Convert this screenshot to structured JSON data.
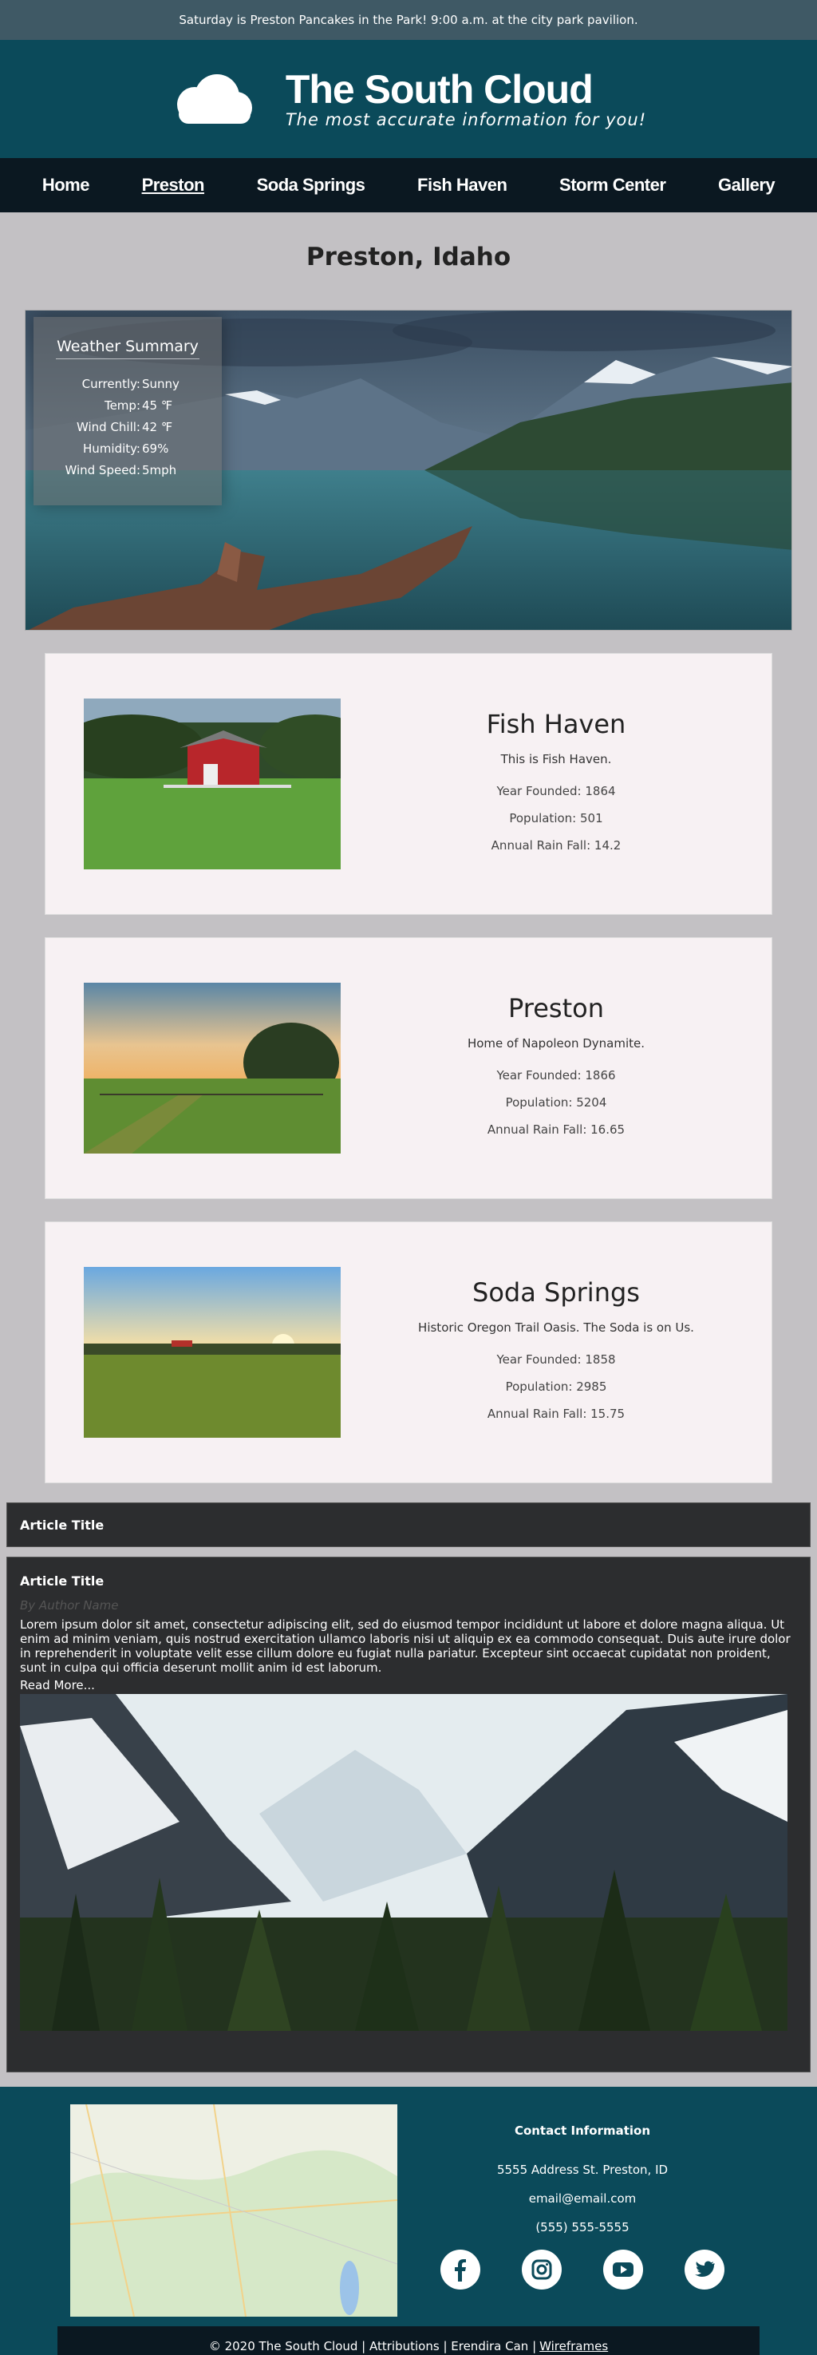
{
  "announcement": "Saturday is Preston Pancakes in the Park! 9:00 a.m. at the city park pavilion.",
  "brand": {
    "title": "The South Cloud",
    "tagline": "The most accurate information for you!",
    "icon": "cloud-icon"
  },
  "nav": {
    "items": [
      {
        "label": "Home"
      },
      {
        "label": "Preston"
      },
      {
        "label": "Soda Springs"
      },
      {
        "label": "Fish Haven"
      },
      {
        "label": "Storm Center"
      },
      {
        "label": "Gallery"
      }
    ],
    "active_index": 1
  },
  "page_title": "Preston, Idaho",
  "weather": {
    "heading": "Weather Summary",
    "rows": [
      {
        "label": "Currently:",
        "value": "Sunny"
      },
      {
        "label": "Temp:",
        "value": "45 ℉"
      },
      {
        "label": "Wind Chill:",
        "value": "42 ℉"
      },
      {
        "label": "Humidity:",
        "value": "69%"
      },
      {
        "label": "Wind Speed:",
        "value": "5mph"
      }
    ]
  },
  "towns": [
    {
      "name": "Fish Haven",
      "motto": "This is Fish Haven.",
      "founded": "Year Founded: 1864",
      "population": "Population: 501",
      "rain": "Annual Rain Fall: 14.2"
    },
    {
      "name": "Preston",
      "motto": "Home of Napoleon Dynamite.",
      "founded": "Year Founded: 1866",
      "population": "Population: 5204",
      "rain": "Annual Rain Fall: 16.65"
    },
    {
      "name": "Soda Springs",
      "motto": "Historic Oregon Trail Oasis. The Soda is on Us.",
      "founded": "Year Founded: 1858",
      "population": "Population: 2985",
      "rain": "Annual Rain Fall: 15.75"
    }
  ],
  "article_bar": {
    "title": "Article Title"
  },
  "article": {
    "title": "Article Title",
    "author": "By Author Name",
    "body": "Lorem ipsum dolor sit amet, consectetur adipiscing elit, sed do eiusmod tempor incididunt ut labore et dolore magna aliqua. Ut enim ad minim veniam, quis nostrud exercitation ullamco laboris nisi ut aliquip ex ea commodo consequat. Duis aute irure dolor in reprehenderit in voluptate velit esse cillum dolore eu fugiat nulla pariatur. Excepteur sint occaecat cupidatat non proident, sunt in culpa qui officia deserunt mollit anim id est laborum.",
    "read_more": "Read More..."
  },
  "contact": {
    "heading": "Contact Information",
    "address": "5555 Address St. Preston, ID",
    "email": "email@email.com",
    "phone": "(555) 555-5555"
  },
  "socials": [
    "facebook-icon",
    "instagram-icon",
    "youtube-icon",
    "twitter-icon"
  ],
  "footer": {
    "copyright": "© 2020 The South Cloud | Attributions | Erendira Can |",
    "wireframes": "Wireframes"
  },
  "colors": {
    "header": "#0b4a5a",
    "nav": "#0b1821",
    "page_bg": "#c3c1c4",
    "card_bg": "#f7f1f3",
    "article_bg": "#2c2d2f"
  }
}
